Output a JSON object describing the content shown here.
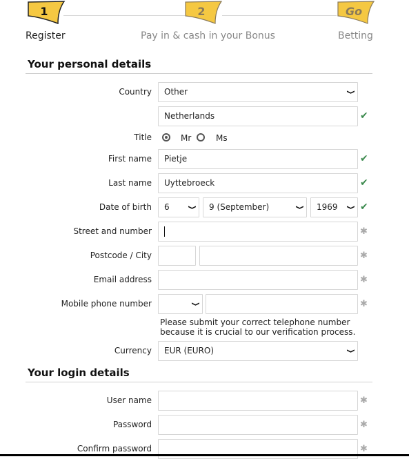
{
  "steps": [
    {
      "badge": "1",
      "label": "Register",
      "state": "active"
    },
    {
      "badge": "2",
      "label": "Pay in & cash in your Bonus",
      "state": "inactive"
    },
    {
      "badge": "Go",
      "label": "Betting",
      "state": "inactive"
    }
  ],
  "colors": {
    "badge_fill": "#f5c842",
    "check": "#3c8a4e",
    "required": "#aaaaaa"
  },
  "personal": {
    "title": "Your personal details",
    "country": {
      "label": "Country",
      "value": "Other",
      "other_value": "Netherlands"
    },
    "title_field": {
      "label": "Title",
      "options": [
        {
          "label": "Mr",
          "selected": true
        },
        {
          "label": "Ms",
          "selected": false
        }
      ]
    },
    "first_name": {
      "label": "First name",
      "value": "Pietje"
    },
    "last_name": {
      "label": "Last name",
      "value": "Uyttebroeck"
    },
    "dob": {
      "label": "Date of birth",
      "day": "6",
      "month": "9 (September)",
      "year": "1969"
    },
    "street": {
      "label": "Street and number",
      "value": ""
    },
    "postcode_city": {
      "label": "Postcode / City",
      "postcode": "",
      "city": ""
    },
    "email": {
      "label": "Email address",
      "value": ""
    },
    "mobile": {
      "label": "Mobile phone number",
      "prefix": "",
      "value": "",
      "hint": "Please submit your correct telephone number because it is crucial to our verification process."
    },
    "currency": {
      "label": "Currency",
      "value": "EUR (EURO)"
    }
  },
  "login": {
    "title": "Your login details",
    "username": {
      "label": "User name",
      "value": ""
    },
    "password": {
      "label": "Password",
      "value": ""
    },
    "confirm_password": {
      "label": "Confirm password",
      "value": ""
    }
  },
  "icons": {
    "check": "✔",
    "required": "✱",
    "chevron": "⌄"
  }
}
